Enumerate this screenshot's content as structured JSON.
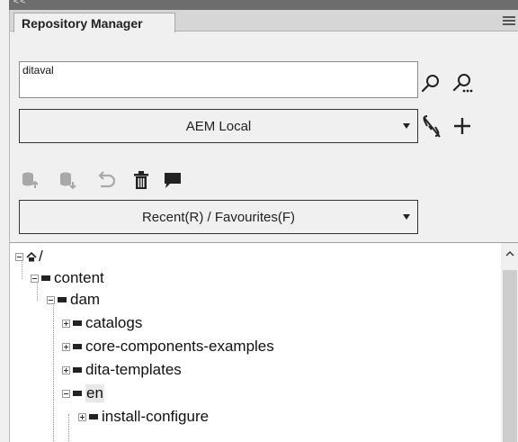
{
  "window": {
    "collapse_glyph": "<<"
  },
  "panel": {
    "tab_title": "Repository Manager",
    "menu_icon": "hamburger-menu-icon"
  },
  "search": {
    "value": "ditaval",
    "search_icon": "search-icon",
    "advanced_search_icon": "advanced-search-icon"
  },
  "connection": {
    "selected": "AEM Local",
    "disconnect_icon": "disconnect-icon",
    "add_icon": "plus-icon"
  },
  "toolbar": {
    "icons": [
      "check-in-icon",
      "check-out-icon",
      "undo-icon",
      "delete-icon",
      "comment-icon"
    ]
  },
  "filter": {
    "selected": "Recent(R) / Favourites(F)"
  },
  "tree": {
    "root": "/",
    "nodes": [
      {
        "label": "content",
        "expanded": true
      },
      {
        "label": "dam",
        "expanded": true
      },
      {
        "label": "catalogs",
        "expanded": false
      },
      {
        "label": "core-components-examples",
        "expanded": false
      },
      {
        "label": "dita-templates",
        "expanded": false
      },
      {
        "label": "en",
        "expanded": true,
        "selected": true
      },
      {
        "label": "install-configure",
        "expanded": false
      }
    ]
  }
}
